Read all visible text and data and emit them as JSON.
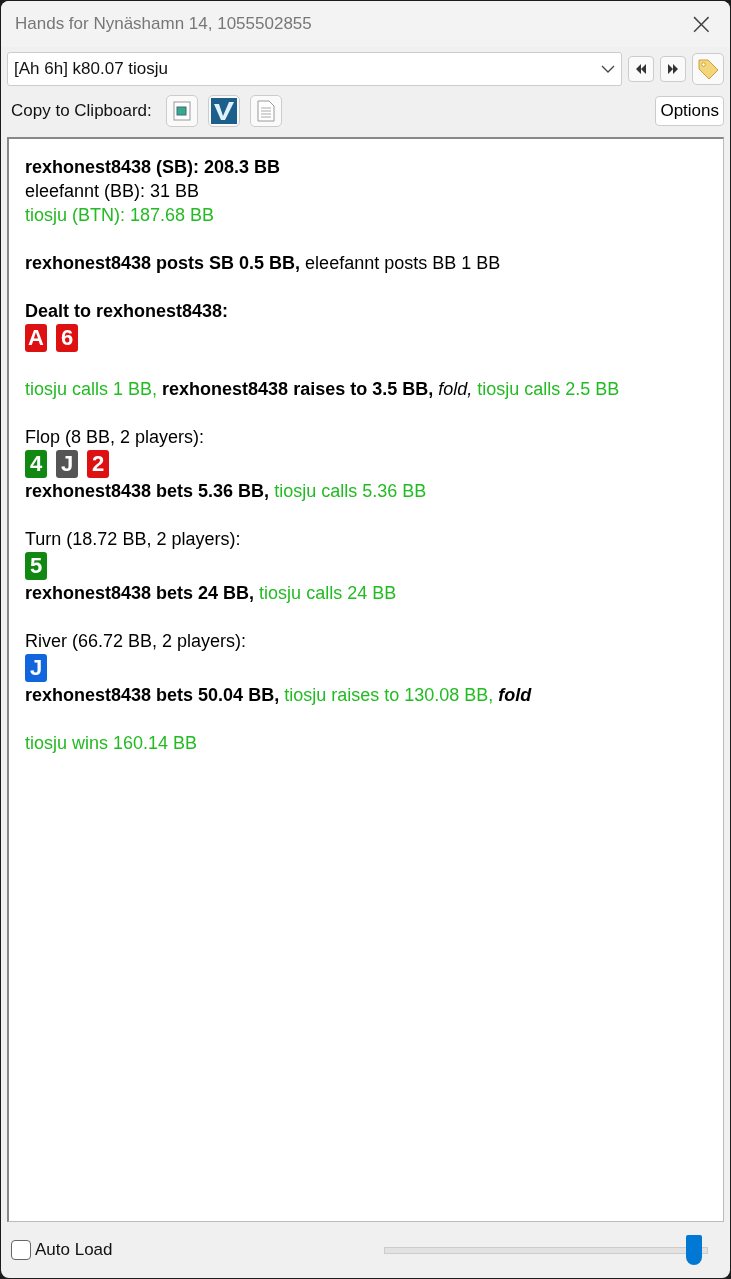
{
  "window": {
    "title": "Hands for Nynäshamn 14, 1055502855",
    "close": "×"
  },
  "hand_select": {
    "value": "[Ah 6h] k80.07 tiosju"
  },
  "toolbar": {
    "label": "Copy to Clipboard:",
    "options_button": "Options"
  },
  "history": [
    {
      "kind": "text",
      "segments": [
        {
          "text": "rexhonest8438 (SB): 208.3 BB",
          "kind": "bold",
          "color": "#000000"
        }
      ]
    },
    {
      "kind": "text",
      "segments": [
        {
          "text": "eleefannt (BB): 31 BB",
          "kind": "plain",
          "color": "#000000"
        }
      ]
    },
    {
      "kind": "text",
      "segments": [
        {
          "text": "tiosju (BTN): 187.68 BB",
          "kind": "plain",
          "color": "#22bb22"
        }
      ]
    },
    {
      "kind": "gap"
    },
    {
      "kind": "text",
      "segments": [
        {
          "text": "rexhonest8438 posts SB 0.5 BB,",
          "kind": "bold",
          "color": "#000000"
        },
        {
          "text": "eleefannt posts BB 1 BB",
          "kind": "plain",
          "color": "#000000"
        }
      ]
    },
    {
      "kind": "gap"
    },
    {
      "kind": "text",
      "segments": [
        {
          "text": "Dealt to rexhonest8438:",
          "kind": "bold",
          "color": "#000000"
        }
      ]
    },
    {
      "kind": "cards",
      "cards": [
        {
          "rank": "A",
          "color": "#dd1111"
        },
        {
          "rank": "6",
          "color": "#dd1111"
        }
      ]
    },
    {
      "kind": "gap"
    },
    {
      "kind": "text",
      "segments": [
        {
          "text": "tiosju calls 1 BB,",
          "kind": "plain",
          "color": "#22bb22"
        },
        {
          "text": "rexhonest8438 raises to 3.5 BB,",
          "kind": "bold",
          "color": "#000000"
        },
        {
          "text": "fold,",
          "kind": "italic",
          "color": "#000000"
        },
        {
          "text": "tiosju calls 2.5 BB",
          "kind": "plain",
          "color": "#22bb22"
        }
      ]
    },
    {
      "kind": "gap"
    },
    {
      "kind": "text",
      "segments": [
        {
          "text": "Flop (8 BB, 2 players):",
          "kind": "plain",
          "color": "#000000"
        }
      ]
    },
    {
      "kind": "cards",
      "cards": [
        {
          "rank": "4",
          "color": "#118811"
        },
        {
          "rank": "J",
          "color": "#555555"
        },
        {
          "rank": "2",
          "color": "#dd1111"
        }
      ]
    },
    {
      "kind": "text",
      "segments": [
        {
          "text": "rexhonest8438 bets 5.36 BB,",
          "kind": "bold",
          "color": "#000000"
        },
        {
          "text": "tiosju calls 5.36 BB",
          "kind": "plain",
          "color": "#22bb22"
        }
      ]
    },
    {
      "kind": "gap"
    },
    {
      "kind": "text",
      "segments": [
        {
          "text": "Turn (18.72 BB, 2 players):",
          "kind": "plain",
          "color": "#000000"
        }
      ]
    },
    {
      "kind": "cards",
      "cards": [
        {
          "rank": "5",
          "color": "#118811"
        }
      ]
    },
    {
      "kind": "text",
      "segments": [
        {
          "text": "rexhonest8438 bets 24 BB,",
          "kind": "bold",
          "color": "#000000"
        },
        {
          "text": "tiosju calls 24 BB",
          "kind": "plain",
          "color": "#22bb22"
        }
      ]
    },
    {
      "kind": "gap"
    },
    {
      "kind": "text",
      "segments": [
        {
          "text": "River (66.72 BB, 2 players):",
          "kind": "plain",
          "color": "#000000"
        }
      ]
    },
    {
      "kind": "cards",
      "cards": [
        {
          "rank": "J",
          "color": "#1166dd"
        }
      ]
    },
    {
      "kind": "text",
      "segments": [
        {
          "text": "rexhonest8438 bets 50.04 BB,",
          "kind": "bold",
          "color": "#000000"
        },
        {
          "text": "tiosju raises to 130.08 BB,",
          "kind": "plain",
          "color": "#22bb22"
        },
        {
          "text": "fold",
          "kind": "bold_italic",
          "color": "#000000"
        }
      ]
    },
    {
      "kind": "gap"
    },
    {
      "kind": "text",
      "segments": [
        {
          "text": "tiosju wins 160.14 BB",
          "kind": "plain",
          "color": "#22bb22"
        }
      ]
    }
  ],
  "footer": {
    "auto_load": {
      "label": "Auto Load",
      "checked": false
    },
    "slider": {
      "level": 0.96
    }
  }
}
